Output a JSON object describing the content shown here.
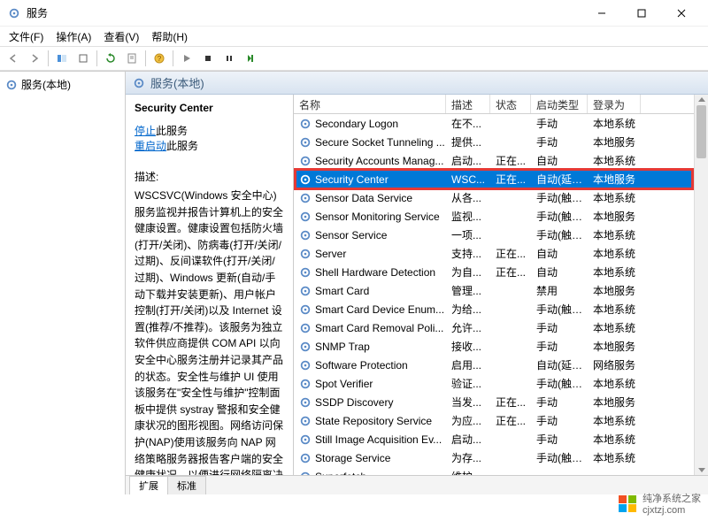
{
  "window": {
    "title": "服务"
  },
  "menu": {
    "items": [
      "文件(F)",
      "操作(A)",
      "查看(V)",
      "帮助(H)"
    ]
  },
  "left_tree": {
    "root": "服务(本地)"
  },
  "header": {
    "title": "服务(本地)"
  },
  "detail": {
    "name": "Security Center",
    "action_stop_label": "停止",
    "action_stop_suffix": "此服务",
    "action_restart_label": "重启动",
    "action_restart_suffix": "此服务",
    "desc_label": "描述:",
    "desc_body": "WSCSVC(Windows 安全中心)服务监视并报告计算机上的安全健康设置。健康设置包括防火墙(打开/关闭)、防病毒(打开/关闭/过期)、反间谍软件(打开/关闭/过期)、Windows 更新(自动/手动下载并安装更新)、用户帐户控制(打开/关闭)以及 Internet 设置(推荐/不推荐)。该服务为独立软件供应商提供 COM API 以向安全中心服务注册并记录其产品的状态。安全性与维护 UI 使用该服务在\"安全性与维护\"控制面板中提供 systray 警报和安全健康状况的图形视图。网络访问保护(NAP)使用该服务向 NAP 网络策略服务器报告客户端的安全健康状况，以便进行网络隔离决策。该服务还提供一个公共"
  },
  "columns": {
    "name": "名称",
    "desc": "描述",
    "status": "状态",
    "startup": "启动类型",
    "logon": "登录为"
  },
  "services": [
    {
      "name": "Secondary Logon",
      "desc": "在不...",
      "status": "",
      "startup": "手动",
      "logon": "本地系统"
    },
    {
      "name": "Secure Socket Tunneling ...",
      "desc": "提供...",
      "status": "",
      "startup": "手动",
      "logon": "本地服务"
    },
    {
      "name": "Security Accounts Manag...",
      "desc": "启动...",
      "status": "正在...",
      "startup": "自动",
      "logon": "本地系统"
    },
    {
      "name": "Security Center",
      "desc": "WSC...",
      "status": "正在...",
      "startup": "自动(延迟...",
      "logon": "本地服务",
      "selected": true
    },
    {
      "name": "Sensor Data Service",
      "desc": "从各...",
      "status": "",
      "startup": "手动(触发...",
      "logon": "本地系统"
    },
    {
      "name": "Sensor Monitoring Service",
      "desc": "监视...",
      "status": "",
      "startup": "手动(触发...",
      "logon": "本地服务"
    },
    {
      "name": "Sensor Service",
      "desc": "一项...",
      "status": "",
      "startup": "手动(触发...",
      "logon": "本地系统"
    },
    {
      "name": "Server",
      "desc": "支持...",
      "status": "正在...",
      "startup": "自动",
      "logon": "本地系统"
    },
    {
      "name": "Shell Hardware Detection",
      "desc": "为自...",
      "status": "正在...",
      "startup": "自动",
      "logon": "本地系统"
    },
    {
      "name": "Smart Card",
      "desc": "管理...",
      "status": "",
      "startup": "禁用",
      "logon": "本地服务"
    },
    {
      "name": "Smart Card Device Enum...",
      "desc": "为给...",
      "status": "",
      "startup": "手动(触发...",
      "logon": "本地系统"
    },
    {
      "name": "Smart Card Removal Poli...",
      "desc": "允许...",
      "status": "",
      "startup": "手动",
      "logon": "本地系统"
    },
    {
      "name": "SNMP Trap",
      "desc": "接收...",
      "status": "",
      "startup": "手动",
      "logon": "本地服务"
    },
    {
      "name": "Software Protection",
      "desc": "启用...",
      "status": "",
      "startup": "自动(延迟...",
      "logon": "网络服务"
    },
    {
      "name": "Spot Verifier",
      "desc": "验证...",
      "status": "",
      "startup": "手动(触发...",
      "logon": "本地系统"
    },
    {
      "name": "SSDP Discovery",
      "desc": "当发...",
      "status": "正在...",
      "startup": "手动",
      "logon": "本地服务"
    },
    {
      "name": "State Repository Service",
      "desc": "为应...",
      "status": "正在...",
      "startup": "手动",
      "logon": "本地系统"
    },
    {
      "name": "Still Image Acquisition Ev...",
      "desc": "启动...",
      "status": "",
      "startup": "手动",
      "logon": "本地系统"
    },
    {
      "name": "Storage Service",
      "desc": "为存...",
      "status": "",
      "startup": "手动(触发...",
      "logon": "本地系统"
    },
    {
      "name": "Superfetch",
      "desc": "维护...",
      "status": "",
      "startup": "",
      "logon": ""
    }
  ],
  "tabs": {
    "extended": "扩展",
    "standard": "标准"
  },
  "watermark": {
    "line1": "纯净系统之家",
    "line2": "cjxtzj.com"
  },
  "colors": {
    "selection": "#0078d7",
    "highlight_border": "#e53935",
    "link": "#0066cc"
  }
}
